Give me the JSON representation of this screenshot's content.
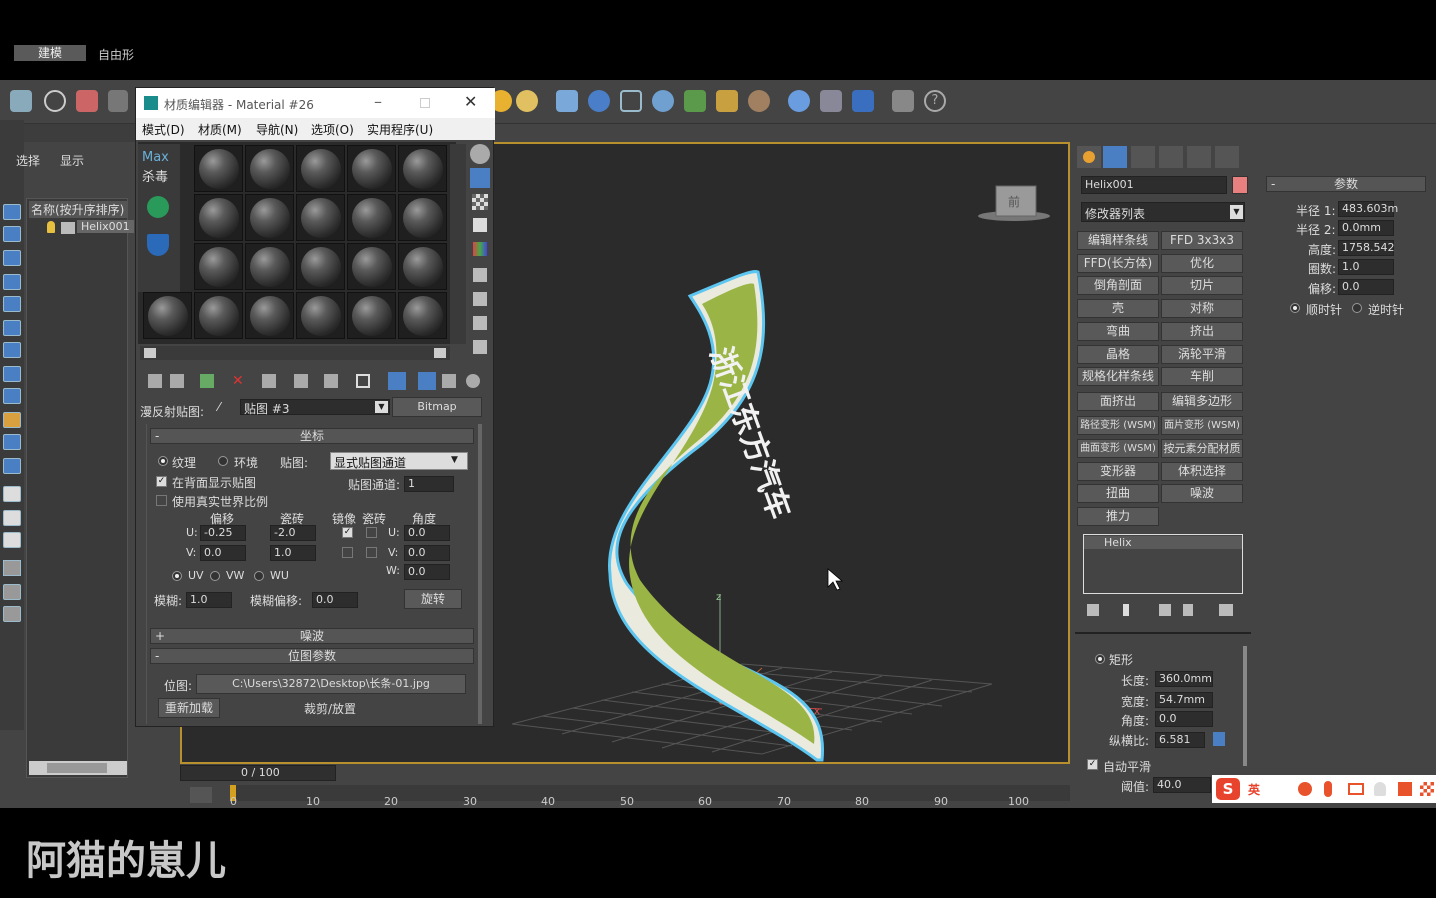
{
  "main_tabs": {
    "build": "建模",
    "freeform": "自由形"
  },
  "scene_explorer": {
    "select_label": "选择",
    "display_label": "显示",
    "sort_header": "名称(按升序排序)",
    "object": "Helix001"
  },
  "material_editor": {
    "title": "材质编辑器 - Material #26",
    "menus": [
      "模式(D)",
      "材质(M)",
      "导航(N)",
      "选项(O)",
      "实用程序(U)"
    ],
    "overlay_logo": {
      "line1": "Max",
      "line2": "杀毒"
    },
    "map_label": "漫反射贴图:",
    "map_name": "贴图 #3",
    "map_type": "Bitmap",
    "coords_rollout": "坐标",
    "texture_label": "纹理",
    "environ_label": "环境",
    "mapping_label": "贴图:",
    "mapping_value": "显式贴图通道",
    "show_back": "在背面显示贴图",
    "real_world": "使用真实世界比例",
    "map_channel_label": "贴图通道:",
    "map_channel_value": "1",
    "col_offset": "偏移",
    "col_tiling": "瓷砖",
    "col_mirror": "镜像",
    "col_tile2": "瓷砖",
    "col_angle": "角度",
    "u_label": "U:",
    "v_label": "V:",
    "w_label": "W:",
    "u_offset": "-0.25",
    "u_tiling": "-2.0",
    "v_offset": "0.0",
    "v_tiling": "1.0",
    "u_angle": "0.0",
    "v_angle": "0.0",
    "w_angle": "0.0",
    "uv": "UV",
    "vw": "VW",
    "wu": "WU",
    "blur_label": "模糊:",
    "blur_value": "1.0",
    "blur_offset_label": "模糊偏移:",
    "blur_offset_value": "0.0",
    "rotate_button": "旋转",
    "noise_rollout": "噪波",
    "bitmap_rollout": "位图参数",
    "bitmap_label": "位图:",
    "bitmap_path": "C:\\Users\\32872\\Desktop\\长条-01.jpg",
    "reload_button": "重新加载",
    "crop_label": "裁剪/放置"
  },
  "viewport": {
    "viewcube_label": "前",
    "ribbon_text": "浙江东方汽车"
  },
  "timeline": {
    "frame_counter": "0 / 100",
    "ticks": [
      "0",
      "10",
      "20",
      "30",
      "40",
      "50",
      "60",
      "70",
      "80",
      "90",
      "100"
    ]
  },
  "command_panel": {
    "object_name": "Helix001",
    "object_color": "#e88080",
    "modifier_list": "修改器列表",
    "modifiers": [
      [
        "编辑样条线",
        "FFD 3x3x3"
      ],
      [
        "FFD(长方体)",
        "优化"
      ],
      [
        "倒角剖面",
        "切片"
      ],
      [
        "壳",
        "对称"
      ],
      [
        "弯曲",
        "挤出"
      ],
      [
        "晶格",
        "涡轮平滑"
      ],
      [
        "规格化样条线",
        "车削"
      ],
      [
        "面挤出",
        "编辑多边形"
      ],
      [
        "路径变形 (WSM)",
        "面片变形 (WSM)"
      ],
      [
        "曲面变形 (WSM)",
        "按元素分配材质"
      ],
      [
        "变形器",
        "体积选择"
      ],
      [
        "扭曲",
        "噪波"
      ],
      [
        "推力",
        ""
      ]
    ],
    "stack_item": "Helix",
    "rect_label": "矩形",
    "length_label": "长度:",
    "length_value": "360.0mm",
    "width_label": "宽度:",
    "width_value": "54.7mm",
    "angle_label": "角度:",
    "angle_value": "0.0",
    "aspect_label": "纵横比:",
    "aspect_value": "6.581",
    "auto_smooth": "自动平滑",
    "threshold_label": "阈值:",
    "threshold_value": "40.0"
  },
  "params_panel": {
    "title": "参数",
    "radius1_label": "半径 1:",
    "radius1_value": "483.603m",
    "radius2_label": "半径 2:",
    "radius2_value": "0.0mm",
    "height_label": "高度:",
    "height_value": "1758.542",
    "turns_label": "圈数:",
    "turns_value": "1.0",
    "bias_label": "偏移:",
    "bias_value": "0.0",
    "cw": "顺时针",
    "ccw": "逆时针"
  },
  "ime_bar": {
    "lang": "英"
  },
  "watermark": "阿猫的崽儿"
}
